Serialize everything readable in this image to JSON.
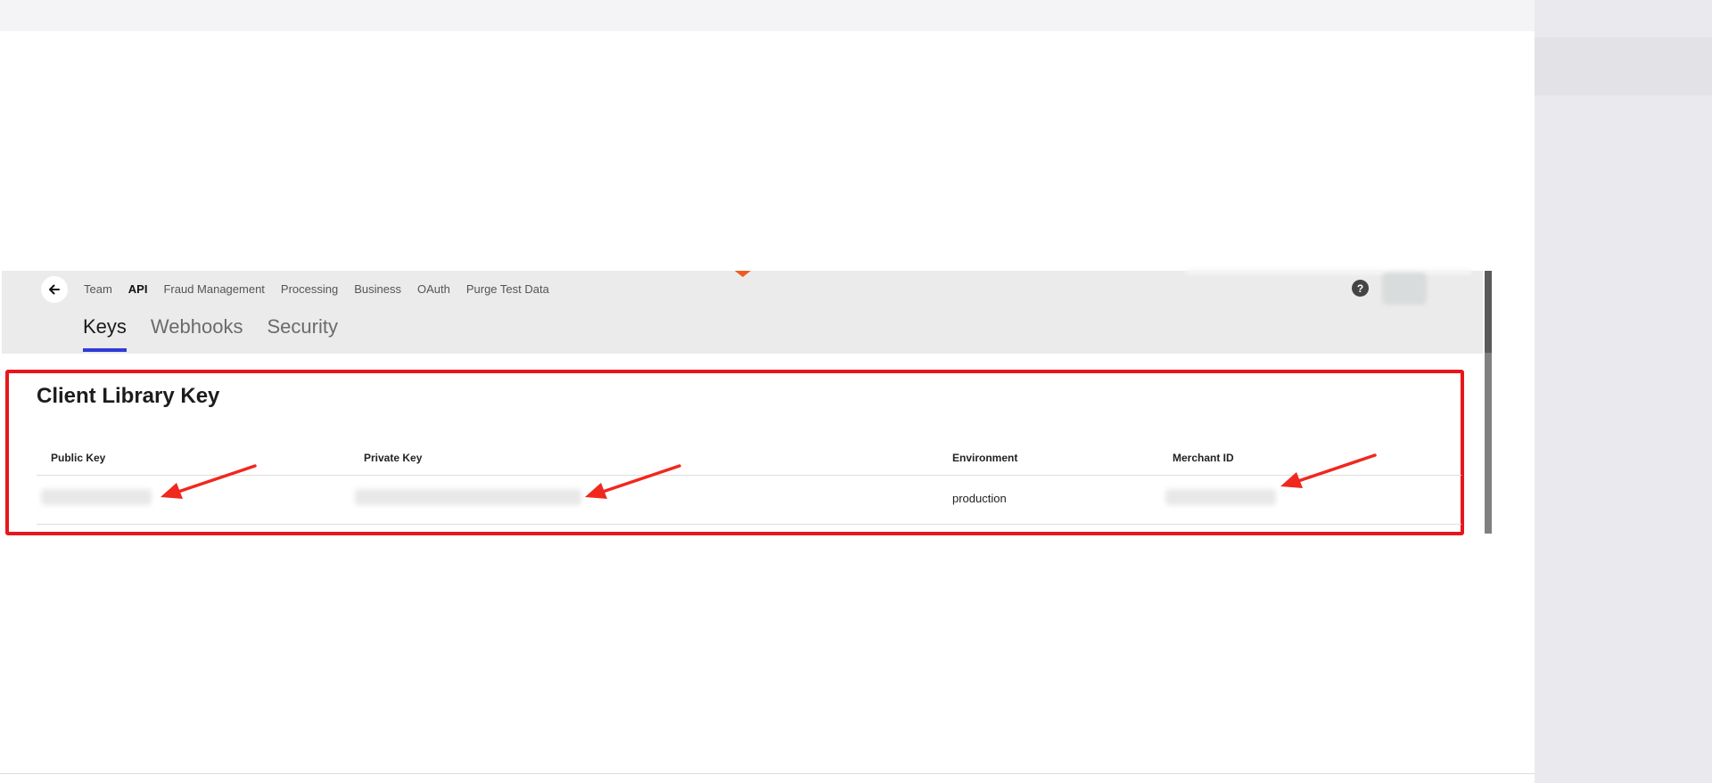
{
  "nav": {
    "links": [
      "Team",
      "API",
      "Fraud Management",
      "Processing",
      "Business",
      "OAuth",
      "Purge Test Data"
    ],
    "active_link": "API",
    "help_label": "?"
  },
  "tabs": [
    {
      "label": "Keys",
      "active": true
    },
    {
      "label": "Webhooks",
      "active": false
    },
    {
      "label": "Security",
      "active": false
    }
  ],
  "card": {
    "title": "Client Library Key",
    "columns": [
      "Public Key",
      "Private Key",
      "Environment",
      "Merchant ID"
    ],
    "row": {
      "public_key": "",
      "private_key": "",
      "environment": "production",
      "merchant_id": ""
    }
  },
  "colors": {
    "highlight_border": "#e8161b",
    "annotation_arrow": "#f0281e",
    "active_tab_underline": "#2f3bd6",
    "notch": "#f05a22"
  },
  "icons": [
    "back-arrow-icon",
    "help-icon"
  ]
}
